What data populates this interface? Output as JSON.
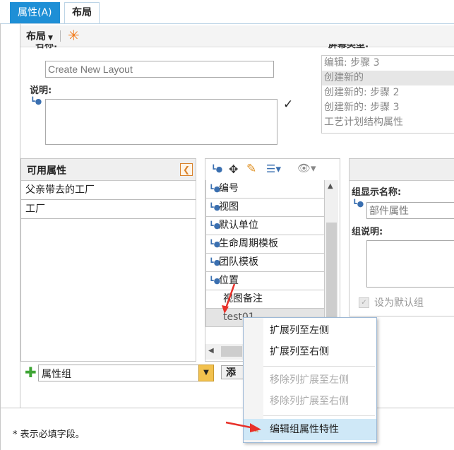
{
  "tabs": [
    {
      "label": "属性(A)",
      "active": true
    },
    {
      "label": "布局",
      "active": false
    }
  ],
  "toolbar": {
    "layout_menu": "布局"
  },
  "form": {
    "name_label": "名称:",
    "name_placeholder": "Create New Layout",
    "desc_label": "说明:",
    "screen_type_label": "屏幕类型:",
    "screen_types": [
      "编辑: 步骤 3",
      "创建新的",
      "创建新的: 步骤 2",
      "创建新的: 步骤 3",
      "工艺计划结构属性"
    ],
    "screen_type_selected": "创建新的"
  },
  "available": {
    "title": "可用属性",
    "items": [
      "父亲带去的工厂",
      "工厂"
    ],
    "group_select_value": "属性组",
    "add_button": "添加"
  },
  "middle": {
    "items": [
      "编号",
      "视图",
      "默认单位",
      "生命周期模板",
      "团队模板",
      "位置",
      "视图备注",
      "test01"
    ],
    "selected": "test01"
  },
  "group": {
    "display_name_label": "组显示名称:",
    "display_name_placeholder": "部件属性",
    "desc_label": "组说明:",
    "default_label": "设为默认组"
  },
  "context_menu": [
    {
      "label": "扩展列至左侧",
      "enabled": true
    },
    {
      "label": "扩展列至右侧",
      "enabled": true
    },
    {
      "label": "移除列扩展至左侧",
      "enabled": false
    },
    {
      "label": "移除列扩展至右侧",
      "enabled": false
    },
    {
      "label": "编辑组属性特性",
      "enabled": true,
      "highlighted": true
    }
  ],
  "footer": {
    "required_note": "* 表示必填字段。"
  },
  "colors": {
    "accent": "#1e8fd6",
    "highlight": "#cfe8f7",
    "arrow": "#e8312a",
    "add_icon": "#3fa535"
  }
}
